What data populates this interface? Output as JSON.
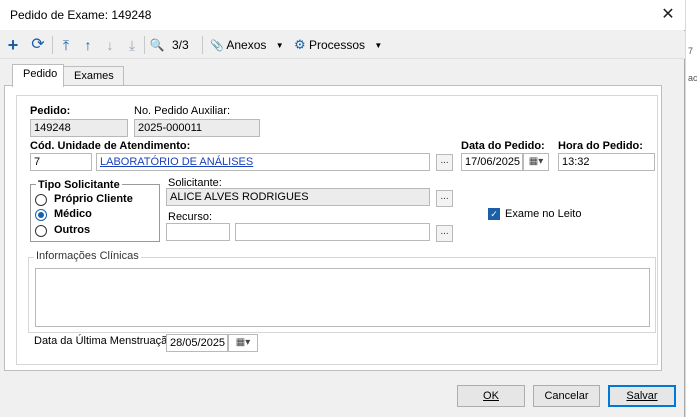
{
  "window": {
    "title": "Pedido de Exame: 149248",
    "close": "✕"
  },
  "toolbar": {
    "add_icon": "+",
    "refresh_icon": "⟳",
    "first_icon": "⤒",
    "prev_icon": "↑",
    "next_icon": "↓",
    "last_icon": "⤓",
    "search_icon": "🔍",
    "record_counter": "3/3",
    "attachments_icon": "📎",
    "attachments_label": "Anexos",
    "processes_icon": "⚙",
    "processes_label": "Processos",
    "caret": "▼"
  },
  "tabs": [
    {
      "label": "Pedido"
    },
    {
      "label": "Exames"
    }
  ],
  "form": {
    "pedido_label": "Pedido:",
    "pedido_value": "149248",
    "pedido_aux_label": "No. Pedido Auxiliar:",
    "pedido_aux_value": "2025-000011",
    "unidade_label": "Cód. Unidade de Atendimento:",
    "unidade_code": "7",
    "unidade_name": "LABORATÓRIO DE ANÁLISES",
    "ellipsis": "...",
    "data_pedido_label": "Data do Pedido:",
    "data_pedido_value": "17/06/2025",
    "hora_pedido_label": "Hora do Pedido:",
    "hora_pedido_value": "13:32",
    "calendar_icon": "▦▾",
    "tipo_solicitante_label": "Tipo Solicitante",
    "tipo_options": [
      "Próprio Cliente",
      "Médico",
      "Outros"
    ],
    "tipo_selected": "Médico",
    "solicitante_label": "Solicitante:",
    "solicitante_value": "ALICE ALVES RODRIGUES",
    "recurso_label": "Recurso:",
    "recurso_code": "",
    "recurso_name": "",
    "exame_leito_label": "Exame no Leito",
    "exame_leito_checked": true,
    "check_mark": "✓",
    "info_clinicas_label": "Informações Clínicas",
    "info_clinicas_value": "",
    "menstruacao_label": "Data da Última Menstruação:",
    "menstruacao_value": "28/05/2025"
  },
  "footer": {
    "ok_label": "OK",
    "cancel_label": "Cancelar",
    "save_label": "Salvar"
  },
  "sidebar_peek": {
    "line1": "7",
    "line2": "ac"
  },
  "colors": {
    "accent": "#1a5fa8",
    "link": "#1a3fbf"
  }
}
